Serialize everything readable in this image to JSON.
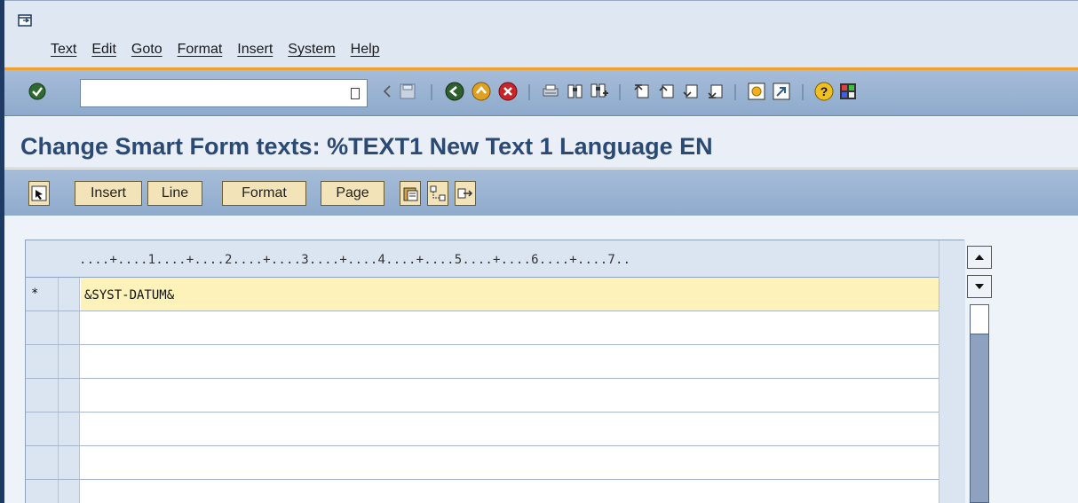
{
  "window": {
    "menu": [
      "Text",
      "Edit",
      "Goto",
      "Format",
      "Insert",
      "System",
      "Help"
    ]
  },
  "toolbar": {
    "command_value": "",
    "icons": [
      "enter-icon",
      "back-nav-icon",
      "save-icon",
      "back-icon",
      "exit-icon",
      "cancel-icon",
      "print-icon",
      "find-icon",
      "find-next-icon",
      "first-page-icon",
      "previous-page-icon",
      "next-page-icon",
      "last-page-icon",
      "create-session-icon",
      "shortcut-icon",
      "help-icon",
      "layout-menu-icon"
    ]
  },
  "page": {
    "title": "Change Smart Form texts: %TEXT1 New Text 1 Language EN"
  },
  "app_toolbar": {
    "insert_label": "Insert",
    "line_label": "Line",
    "format_label": "Format",
    "page_label": "Page"
  },
  "editor": {
    "ruler": "....+....1....+....2....+....3....+....4....+....5....+....6....+....7..",
    "lines": [
      {
        "marker": "*",
        "text": "&SYST-DATUM&"
      },
      {
        "marker": "",
        "text": ""
      },
      {
        "marker": "",
        "text": ""
      },
      {
        "marker": "",
        "text": ""
      },
      {
        "marker": "",
        "text": ""
      },
      {
        "marker": "",
        "text": ""
      },
      {
        "marker": "",
        "text": ""
      }
    ]
  },
  "colors": {
    "title": "#2a4a74",
    "toolbar": "#9bb4d4",
    "active_line": "#fdf2b9",
    "accent_line": "#f0a030"
  }
}
